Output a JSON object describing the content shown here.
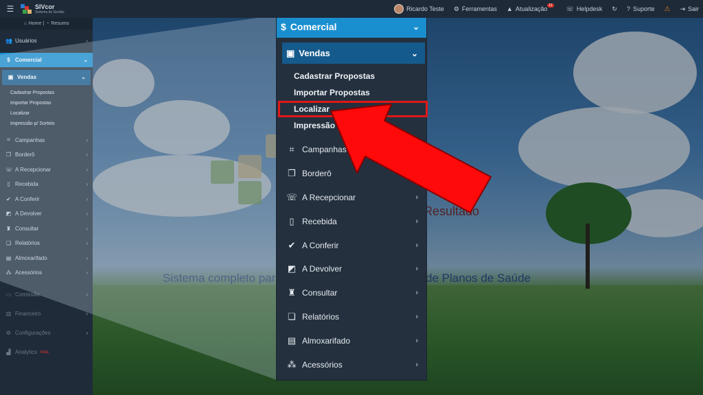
{
  "topbar": {
    "brand_name": "SIVcor",
    "brand_sub": "Sistema de Gestão",
    "user": "Ricardo Teste",
    "tools": "Ferramentas",
    "update": "Atualização",
    "update_badge": "11",
    "helpdesk": "Helpdesk",
    "support": "Suporte",
    "exit": "Sair"
  },
  "sidebar": {
    "home": "Home | ",
    "summary": "Resumo",
    "users": "Usuários",
    "commercial": "Comercial",
    "sales": "Vendas",
    "sub_items": [
      "Cadastrar Propostas",
      "Importar Propostas",
      "Localizar",
      "Impressão p/ Sorteio"
    ],
    "items": [
      "Campanhas",
      "Borderô",
      "A Recepcionar",
      "Recebida",
      "A Conferir",
      "A Devolver",
      "Consultar",
      "Relatórios",
      "Almoxarifado",
      "Acessórios"
    ],
    "after": [
      "Comissão",
      "Financeiro",
      "Configurações",
      "Analytics"
    ],
    "beta": "beta"
  },
  "zoom": {
    "commercial": "Comercial",
    "sales": "Vendas",
    "sub_items": [
      "Cadastrar Propostas",
      "Importar Propostas",
      "Localizar",
      "Impressão p/"
    ],
    "items": [
      "Campanhas",
      "Borderô",
      "A Recepcionar",
      "Recebida",
      "A Conferir",
      "A Devolver",
      "Consultar",
      "Relatórios",
      "Almoxarifado",
      "Acessórios"
    ]
  },
  "scene": {
    "caption_left": "Sistema completo para",
    "caption_right": "de Planos de Saúde",
    "logo_fragment": "Resultado"
  },
  "colors": {
    "accent": "#1a8fd0",
    "sub_active": "#155a8c",
    "highlight": "#e01818",
    "sidebar_bg": "#1f2b39"
  }
}
